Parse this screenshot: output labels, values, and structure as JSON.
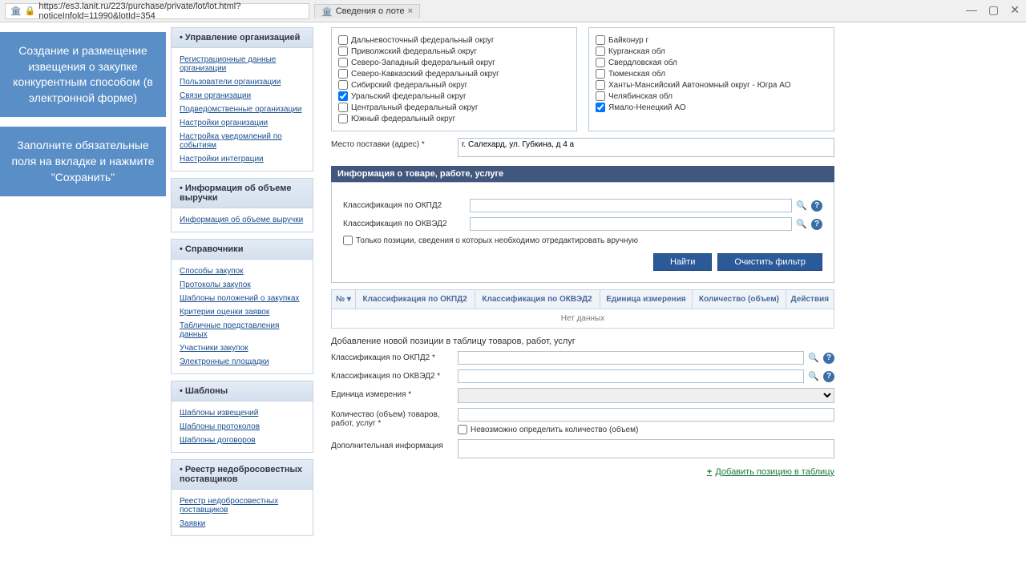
{
  "browser": {
    "url": "https://es3.lanit.ru/223/purchase/private/lot/lot.html?noticeInfold=11990&lotId=354",
    "tab_title": "Сведения о лоте"
  },
  "bluecards": {
    "card1": "Создание и размещение извещения о закупке конкурентным способом (в электронной форме)",
    "card2": "Заполните обязательные поля на вкладке и нажмите \"Сохранить\""
  },
  "sidegroups": [
    {
      "title": "Управление организацией",
      "links": [
        "Регистрационные данные организации",
        "Пользователи организации",
        "Связи организации",
        "Подведомственные организации",
        "Настройки организации",
        "Настройка уведомлений по событиям",
        "Настройки интеграции"
      ]
    },
    {
      "title": "Информация об объеме выручки",
      "links": [
        "Информация об объеме выручки"
      ]
    },
    {
      "title": "Справочники",
      "links": [
        "Способы закупок",
        "Протоколы закупок",
        "Шаблоны положений о закупках",
        "Критерии оценки заявок",
        "Табличные представления данных",
        "Участники закупок",
        "Электронные площадки"
      ]
    },
    {
      "title": "Шаблоны",
      "links": [
        "Шаблоны извещений",
        "Шаблоны протоколов",
        "Шаблоны договоров"
      ]
    },
    {
      "title": "Реестр недобросовестных поставщиков",
      "links": [
        "Реестр недобросовестных поставщиков",
        "Заявки"
      ]
    }
  ],
  "regions": {
    "col1": [
      {
        "label": "Дальневосточный федеральный округ",
        "checked": false
      },
      {
        "label": "Приволжский федеральный округ",
        "checked": false
      },
      {
        "label": "Северо-Западный федеральный округ",
        "checked": false
      },
      {
        "label": "Северо-Кавказский федеральный округ",
        "checked": false
      },
      {
        "label": "Сибирский федеральный округ",
        "checked": false
      },
      {
        "label": "Уральский федеральный округ",
        "checked": true
      },
      {
        "label": "Центральный федеральный округ",
        "checked": false
      },
      {
        "label": "Южный федеральный округ",
        "checked": false
      }
    ],
    "col2": [
      {
        "label": "Байконур г",
        "checked": false
      },
      {
        "label": "Курганская обл",
        "checked": false
      },
      {
        "label": "Свердловская обл",
        "checked": false
      },
      {
        "label": "Тюменская обл",
        "checked": false
      },
      {
        "label": "Ханты-Мансийский Автономный округ - Югра АО",
        "checked": false
      },
      {
        "label": "Челябинская обл",
        "checked": false
      },
      {
        "label": "Ямало-Ненецкий АО",
        "checked": true
      }
    ]
  },
  "delivery": {
    "label": "Место поставки (адрес) *",
    "value": "г. Салехард, ул. Губкина, д 4 а"
  },
  "sectionTitle": "Информация о товаре, работе, услуге",
  "filter": {
    "okpd2_label": "Классификация по ОКПД2",
    "okved2_label": "Классификация по ОКВЭД2",
    "onlyedit_label": "Только позиции, сведения о которых необходимо отредактировать вручную",
    "find_btn": "Найти",
    "clear_btn": "Очистить фильтр"
  },
  "table": {
    "cols": [
      "№",
      "Классификация по ОКПД2",
      "Классификация по ОКВЭД2",
      "Единица измерения",
      "Количество (объем)",
      "Действия"
    ],
    "nodata": "Нет данных"
  },
  "addpos": {
    "header": "Добавление новой позиции в таблицу товаров, работ, услуг",
    "okpd2_label": "Классификация по ОКПД2 *",
    "okved2_label": "Классификация по ОКВЭД2 *",
    "unit_label": "Единица измерения *",
    "qty_label": "Количество (объем) товаров, работ, услуг *",
    "qty_chk": "Невозможно определить количество (объем)",
    "extra_label": "Дополнительная информация",
    "addlink": "Добавить позицию в таблицу"
  }
}
